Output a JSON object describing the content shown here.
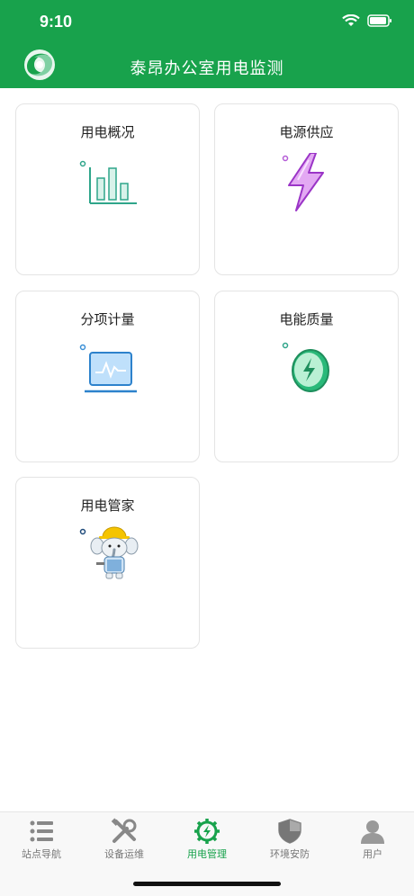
{
  "status": {
    "time": "9:10"
  },
  "header": {
    "title": "泰昂办公室用电监测"
  },
  "cards": [
    {
      "label": "用电概况",
      "icon": "bar-chart-icon"
    },
    {
      "label": "电源供应",
      "icon": "lightning-bolt-icon"
    },
    {
      "label": "分项计量",
      "icon": "laptop-monitor-icon"
    },
    {
      "label": "电能质量",
      "icon": "energy-coin-icon"
    },
    {
      "label": "用电管家",
      "icon": "mascot-elephant-icon"
    }
  ],
  "tabbar": {
    "items": [
      {
        "label": "站点导航",
        "icon": "list-icon"
      },
      {
        "label": "设备运维",
        "icon": "tools-icon"
      },
      {
        "label": "用电管理",
        "icon": "power-gear-icon",
        "active": true
      },
      {
        "label": "环境安防",
        "icon": "shield-icon"
      },
      {
        "label": "用户",
        "icon": "user-icon"
      }
    ]
  },
  "colors": {
    "brand": "#18a24c",
    "inactive": "#777777"
  }
}
